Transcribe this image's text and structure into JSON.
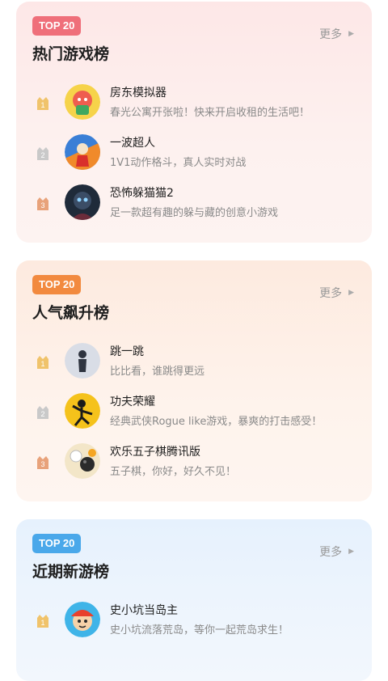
{
  "sections": [
    {
      "badge": "TOP 20",
      "title": "热门游戏榜",
      "more": "更多",
      "items": [
        {
          "rank": "1",
          "name": "房东模拟器",
          "desc": "春光公寓开张啦！快来开启收租的生活吧！",
          "icon": "landlord-game-icon"
        },
        {
          "rank": "2",
          "name": "一波超人",
          "desc": "1V1动作格斗，真人实时对战",
          "icon": "wave-hero-game-icon"
        },
        {
          "rank": "3",
          "name": "恐怖躲猫猫2",
          "desc": "足一款超有趣的躲与藏的创意小游戏",
          "icon": "horror-hide-seek-game-icon"
        }
      ]
    },
    {
      "badge": "TOP 20",
      "title": "人气飙升榜",
      "more": "更多",
      "items": [
        {
          "rank": "1",
          "name": "跳一跳",
          "desc": "比比看，谁跳得更远",
          "icon": "jump-game-icon"
        },
        {
          "rank": "2",
          "name": "功夫荣耀",
          "desc": "经典武侠Rogue like游戏，暴爽的打击感受！",
          "icon": "kungfu-glory-game-icon"
        },
        {
          "rank": "3",
          "name": "欢乐五子棋腾讯版",
          "desc": "五子棋，你好，好久不见！",
          "icon": "gomoku-game-icon"
        }
      ]
    },
    {
      "badge": "TOP 20",
      "title": "近期新游榜",
      "more": "更多",
      "items": [
        {
          "rank": "1",
          "name": "史小坑当岛主",
          "desc": "史小坑流落荒岛，等你一起荒岛求生！",
          "icon": "island-owner-game-icon"
        }
      ]
    }
  ],
  "colors": {
    "badge_pink": "#ef6f7a",
    "badge_orange": "#f28a3f",
    "badge_blue": "#4aa8ea",
    "rank_gold": "#f0c36b",
    "rank_silver": "#c9c9c9",
    "rank_bronze": "#e8a27a"
  }
}
